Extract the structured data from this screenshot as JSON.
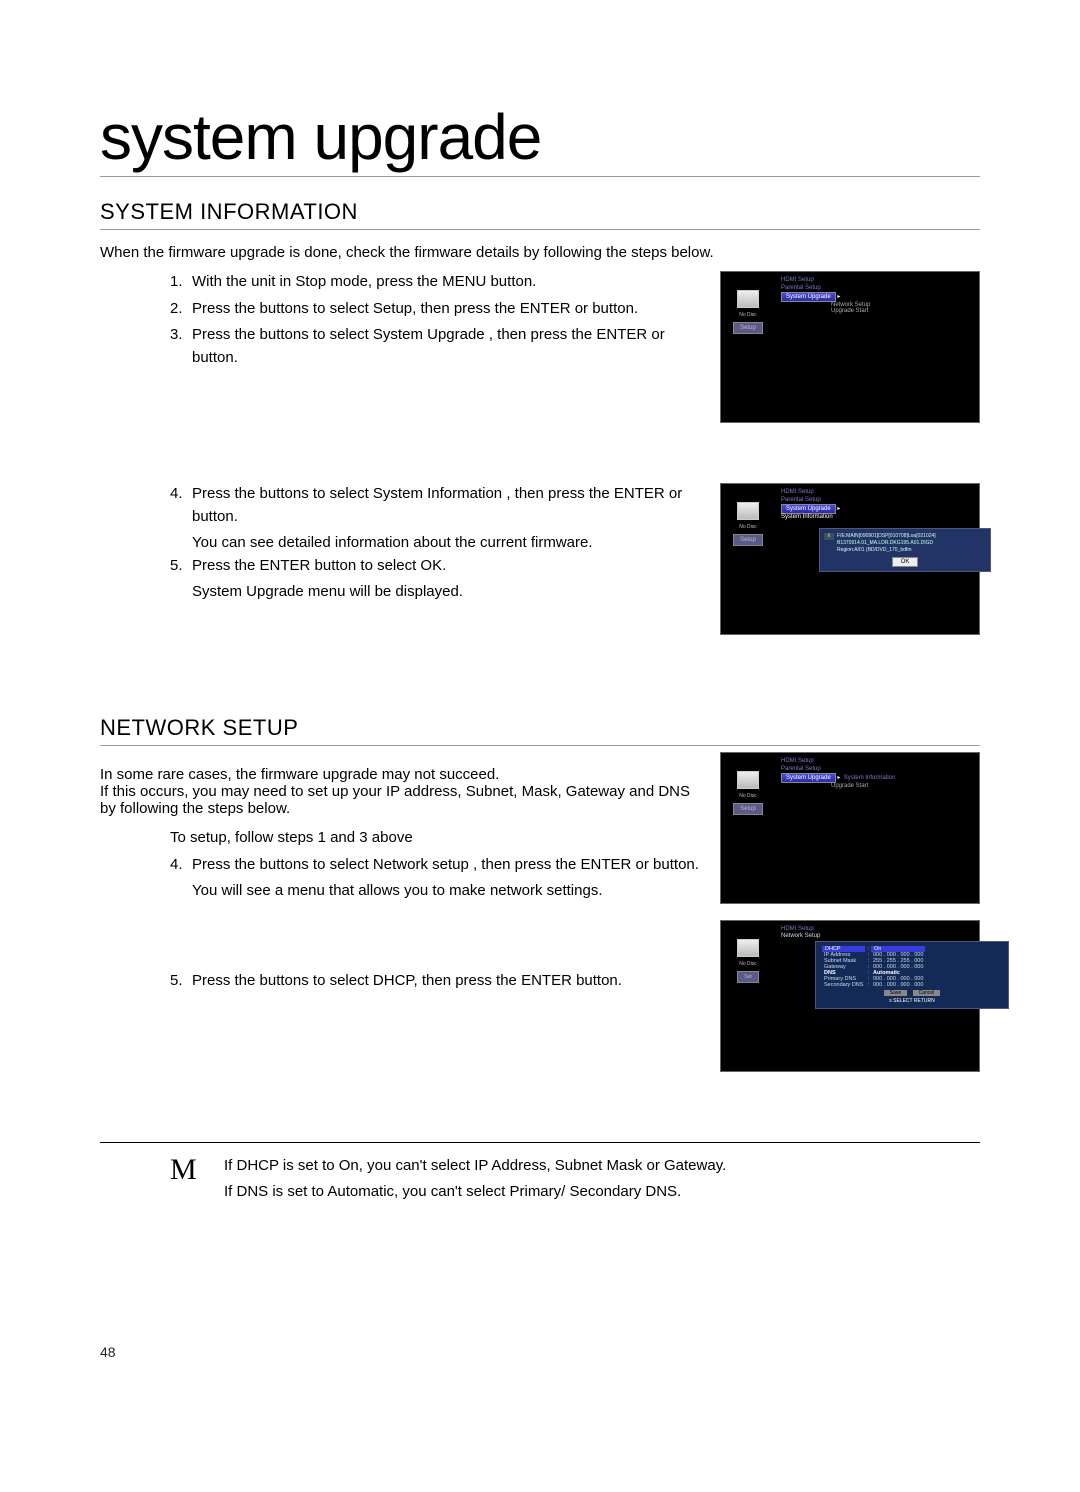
{
  "title": "system upgrade",
  "section1": {
    "heading": "SYSTEM INFORMATION",
    "intro": "When the ﬁrmware upgrade is done, check the ﬁrmware details by following the steps below.",
    "step1_num": "1.",
    "step1": "With the unit in Stop mode, press the MENU button.",
    "step2_num": "2.",
    "step2_a": "Press the ",
    "step2_b": " buttons to select Setup, then press the ENTER or ",
    "step2_c": " button.",
    "step3_num": "3.",
    "step3_a": "Press the ",
    "step3_b": " buttons to select System Upgrade , then press the ENTER or ",
    "step3_c": " button.",
    "step4_num": "4.",
    "step4_a": "Press the ",
    "step4_b": " buttons to select System Information , then press the ENTER or ",
    "step4_c": " button.",
    "step4_sub": "You can see detailed information about the current ﬁrmware.",
    "step5_num": "5.",
    "step5": "Press the ENTER button to select OK.",
    "step5_sub": "System Upgrade menu will be displayed."
  },
  "section2": {
    "heading": "NETWORK SETUP",
    "intro1": "In some rare cases, the ﬁrmware upgrade may not succeed.",
    "intro2": "If this occurs, you may need to set up your IP address, Subnet, Mask, Gateway and DNS by following the steps below.",
    "pre": "To setup, follow steps 1 and 3 above",
    "step4_num": "4.",
    "step4_a": "Press the ",
    "step4_b": " buttons to select Network setup , then press the ENTER or ",
    "step4_c": " button.",
    "step4_sub": "You will see a menu that allows you to make network settings.",
    "step5_num": "5.",
    "step5_a": "Press the ",
    "step5_b": " buttons to select DHCP, then press the ENTER button."
  },
  "note": {
    "icon": "M",
    "line1": "If DHCP is set to On, you can't select IP Address, Subnet Mask or Gateway.",
    "line2": "If DNS is set to Automatic, you can't select Primary/ Secondary DNS."
  },
  "pagenum": "48",
  "shot": {
    "nodisc": "No Disc",
    "setup": "Setup",
    "hdmi": "HDMI Setup",
    "parental": "Parental Setup",
    "sysupgrade": "System Upgrade",
    "networksetup": "Network Setup",
    "upgradestart": "Upgrade Start",
    "sysinfo": "System Information",
    "popup_l1": "F/E:MAIN[090901]DSP[010708]Loa[021024]",
    "popup_l2": "B1370914.01_MA.LDR.DKG195.A01.DIGD",
    "popup_l3": "Region:A/01 (BD/DVD_170_bdfm",
    "ok": "OK",
    "net_title": "Network Setup",
    "dhcp": "DHCP",
    "dhcp_v": "On",
    "ip": "IP Address",
    "ip_v": "000 . 000 . 000 . 000",
    "subnet": "Subnet Mask",
    "subnet_v": "255 . 255 . 255 . 000",
    "gateway": "Gateway",
    "gateway_v": "000 . 000 . 000 . 000",
    "dns": "DNS",
    "dns_v": "Automatic",
    "pdns": "Primary DNS",
    "pdns_v": "000 . 000 . 000 . 000",
    "sdns": "Secondary DNS",
    "sdns_v": "000 . 000 . 000 . 000",
    "save": "Save",
    "cancel": "Cancel",
    "footer": "s   SELECT        RETURN"
  }
}
